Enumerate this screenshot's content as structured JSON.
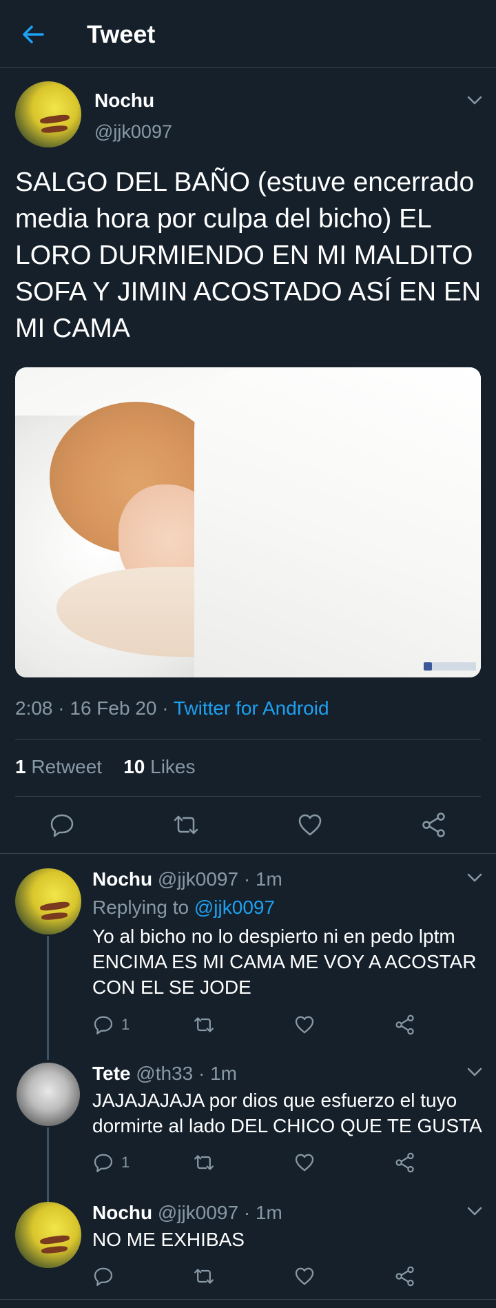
{
  "header": {
    "title": "Tweet",
    "back_icon": "arrow-left-icon"
  },
  "colors": {
    "background": "#15202b",
    "accent": "#1da1f2",
    "muted": "#8899a6",
    "divider": "#38444d"
  },
  "main_tweet": {
    "name": "Nochu",
    "handle": "@jjk0097",
    "text": "SALGO DEL BAÑO (estuve encerrado media hora por culpa del bicho) EL LORO DURMIENDO EN MI MALDITO SOFA Y JIMIN ACOSTADO ASÍ EN EN MI CAMA",
    "time": "2:08 · 16 Feb 20 · ",
    "source": "Twitter for Android",
    "retweets_count": "1",
    "retweets_label": "Retweet",
    "likes_count": "10",
    "likes_label": "Likes"
  },
  "replies": [
    {
      "name": "Nochu",
      "meta": " @jjk0097 · 1m",
      "replying_prefix": "Replying to ",
      "replying_handle": "@jjk0097",
      "text": "Yo al bicho no lo despierto ni en pedo lptm ENCIMA ES MI CAMA ME VOY A ACOSTAR CON EL SE JODE",
      "reply_count": "1"
    },
    {
      "name": "Tete",
      "meta": " @th33 · 1m",
      "text": "JAJAJAJAJA por dios que esfuerzo el tuyo dormirte al lado DEL CHICO QUE TE GUSTA",
      "reply_count": "1"
    },
    {
      "name": "Nochu",
      "meta": " @jjk0097 · 1m",
      "text": "NO ME EXHIBAS"
    }
  ]
}
